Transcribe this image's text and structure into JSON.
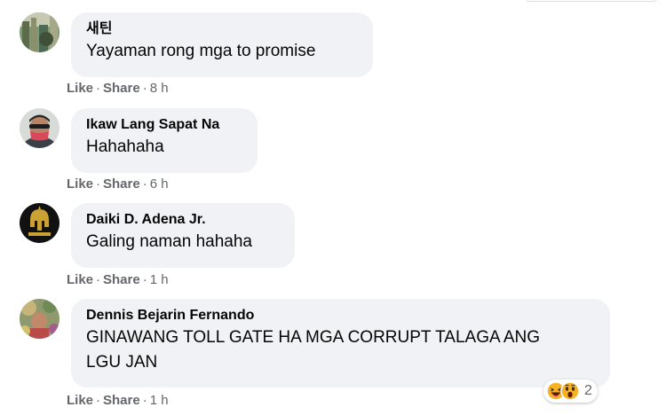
{
  "comments": [
    {
      "author": "새틴",
      "text": "Yayaman rong mga to promise",
      "like_label": "Like",
      "share_label": "Share",
      "time": "8 h"
    },
    {
      "author": "Ikaw Lang Sapat Na",
      "text": "Hahahaha",
      "like_label": "Like",
      "share_label": "Share",
      "time": "6 h"
    },
    {
      "author": "Daiki D. Adena Jr.",
      "text": "Galing naman hahaha",
      "like_label": "Like",
      "share_label": "Share",
      "time": "1 h"
    },
    {
      "author": "Dennis Bejarin Fernando",
      "text_line1": "GINAWANG TOLL GATE HA MGA CORRUPT TALAGA ANG",
      "text_line2": "LGU JAN",
      "like_label": "Like",
      "share_label": "Share",
      "time": "1 h",
      "reactions": {
        "icons": [
          "haha-emoji-icon",
          "wow-emoji-icon"
        ],
        "count": "2"
      }
    }
  ],
  "separator": "·",
  "colors": {
    "bubble": "#f0f2f5",
    "secondary_text": "#65676b",
    "primary_text": "#050505",
    "reaction_yellow": "#f7b125"
  }
}
